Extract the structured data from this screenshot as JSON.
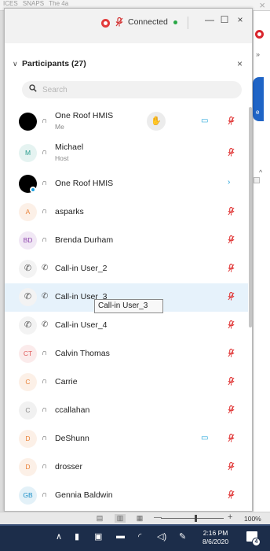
{
  "browser": {
    "tab_fragments": [
      "ICES",
      "SNAPS",
      "The 4a"
    ],
    "close_glyph": "×",
    "side_blue_text": "e"
  },
  "meeting": {
    "status_label": "Connected",
    "status_color": "#28a745",
    "record_color": "#e23b3b",
    "window_controls": {
      "minimize": "—",
      "maximize": "☐",
      "close": "×"
    }
  },
  "participants_panel": {
    "title": "Participants (27)",
    "close_glyph": "×",
    "search_placeholder": "Search",
    "tooltip": "Call-in User_3",
    "participants": [
      {
        "name": "One Roof HMIS",
        "role": "Me",
        "avatar_text": "",
        "avatar_color": "#000000",
        "raised_hand": true,
        "video_on": true,
        "muted": true
      },
      {
        "name": "Michael",
        "role": "Host",
        "avatar_text": "M",
        "avatar_color": "#2a9d8f",
        "raised_hand": false,
        "video_on": false,
        "muted": true
      },
      {
        "name": "One Roof HMIS",
        "role": "",
        "avatar_text": "",
        "avatar_color": "#000000",
        "raised_hand": false,
        "video_on": false,
        "muted": false
      },
      {
        "name": "asparks",
        "role": "",
        "avatar_text": "A",
        "avatar_color": "#e8833a",
        "raised_hand": false,
        "video_on": false,
        "muted": true
      },
      {
        "name": "Brenda Durham",
        "role": "",
        "avatar_text": "BD",
        "avatar_color": "#8e44ad",
        "raised_hand": false,
        "video_on": false,
        "muted": true
      },
      {
        "name": "Call-in User_2",
        "role": "",
        "avatar_text": "",
        "avatar_color": "#555555",
        "raised_hand": false,
        "video_on": false,
        "muted": true
      },
      {
        "name": "Call-in User_3",
        "role": "",
        "avatar_text": "",
        "avatar_color": "#555555",
        "raised_hand": false,
        "video_on": false,
        "muted": true
      },
      {
        "name": "Call-in User_4",
        "role": "",
        "avatar_text": "",
        "avatar_color": "#555555",
        "raised_hand": false,
        "video_on": false,
        "muted": true
      },
      {
        "name": "Calvin Thomas",
        "role": "",
        "avatar_text": "CT",
        "avatar_color": "#e05d5d",
        "raised_hand": false,
        "video_on": false,
        "muted": true
      },
      {
        "name": "Carrie",
        "role": "",
        "avatar_text": "C",
        "avatar_color": "#e8833a",
        "raised_hand": false,
        "video_on": false,
        "muted": true
      },
      {
        "name": "ccallahan",
        "role": "",
        "avatar_text": "C",
        "avatar_color": "#888888",
        "raised_hand": false,
        "video_on": false,
        "muted": true
      },
      {
        "name": "DeShunn",
        "role": "",
        "avatar_text": "D",
        "avatar_color": "#e8833a",
        "raised_hand": false,
        "video_on": true,
        "muted": true
      },
      {
        "name": "drosser",
        "role": "",
        "avatar_text": "D",
        "avatar_color": "#e8833a",
        "raised_hand": false,
        "video_on": false,
        "muted": true
      },
      {
        "name": "Gennia Baldwin",
        "role": "",
        "avatar_text": "GB",
        "avatar_color": "#1a8fc7",
        "raised_hand": false,
        "video_on": false,
        "muted": true
      }
    ]
  },
  "status_bar": {
    "zoom_level": "100%",
    "zoom_minus": "—",
    "zoom_plus": "+"
  },
  "taskbar": {
    "time": "2:16 PM",
    "date": "8/6/2020",
    "notification_count": "4"
  }
}
